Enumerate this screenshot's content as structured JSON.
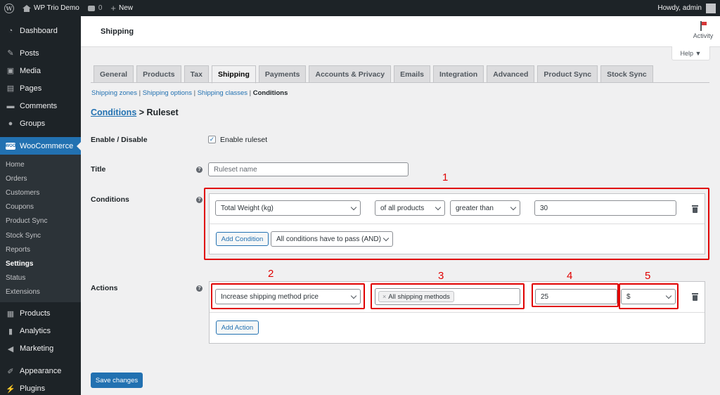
{
  "adminbar": {
    "site_name": "WP Trio Demo",
    "comments_count": "0",
    "new_label": "New",
    "howdy": "Howdy, admin"
  },
  "sidebar": {
    "top_items": [
      {
        "label": "Dashboard",
        "icon": "dashboard-icon"
      },
      {
        "label": "Posts",
        "icon": "pin-icon"
      },
      {
        "label": "Media",
        "icon": "media-icon"
      },
      {
        "label": "Pages",
        "icon": "pages-icon"
      },
      {
        "label": "Comments",
        "icon": "comment-icon"
      },
      {
        "label": "Groups",
        "icon": "groups-icon"
      }
    ],
    "woocommerce": "WooCommerce",
    "woo_badge": "WOO",
    "sub_items": [
      "Home",
      "Orders",
      "Customers",
      "Coupons",
      "Product Sync",
      "Stock Sync",
      "Reports",
      "Settings",
      "Status",
      "Extensions"
    ],
    "bottom_items": [
      {
        "label": "Products",
        "icon": "products-icon"
      },
      {
        "label": "Analytics",
        "icon": "analytics-icon"
      },
      {
        "label": "Marketing",
        "icon": "megaphone-icon"
      },
      {
        "label": "Appearance",
        "icon": "brush-icon"
      },
      {
        "label": "Plugins",
        "icon": "plugin-icon"
      }
    ]
  },
  "header": {
    "title": "Shipping",
    "activity": "Activity",
    "help": "Help ▼"
  },
  "tabs": [
    "General",
    "Products",
    "Tax",
    "Shipping",
    "Payments",
    "Accounts & Privacy",
    "Emails",
    "Integration",
    "Advanced",
    "Product Sync",
    "Stock Sync"
  ],
  "subsub": {
    "zones": "Shipping zones",
    "options": "Shipping options",
    "classes": "Shipping classes",
    "conditions": "Conditions",
    "sep": " | "
  },
  "breadcrumb": {
    "link": "Conditions",
    "rest": " > Ruleset"
  },
  "form": {
    "enable_label": "Enable / Disable",
    "enable_checkbox": "Enable ruleset",
    "title_label": "Title",
    "title_placeholder": "Ruleset name",
    "conditions_label": "Conditions",
    "condition": {
      "field": "Total Weight (kg)",
      "scope": "of all products",
      "operator": "greater than",
      "value": "30"
    },
    "add_condition": "Add Condition",
    "logic": "All conditions have to pass (AND)",
    "actions_label": "Actions",
    "action": {
      "type": "Increase shipping method price",
      "methods_tag": "All shipping methods",
      "amount": "25",
      "unit": "$"
    },
    "add_action": "Add Action",
    "save": "Save changes"
  },
  "annotations": [
    "1",
    "2",
    "3",
    "4",
    "5"
  ],
  "colors": {
    "accent": "#2271b1",
    "sidebar_bg": "#1d2327",
    "annotation_red": "#e00000"
  }
}
